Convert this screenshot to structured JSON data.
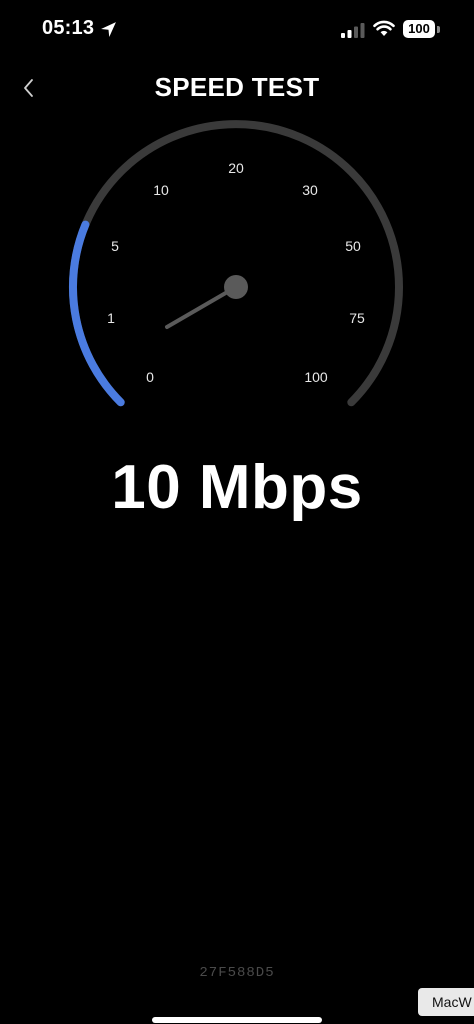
{
  "status_bar": {
    "time": "05:13",
    "battery": "100",
    "icons": [
      "location-arrow-icon",
      "cellular-signal-icon",
      "wifi-icon",
      "battery-icon"
    ]
  },
  "header": {
    "back_icon": "chevron-left-icon",
    "title": "SPEED TEST"
  },
  "gauge": {
    "tick_labels": [
      "0",
      "1",
      "5",
      "10",
      "20",
      "30",
      "50",
      "75",
      "100"
    ],
    "current_value": 10,
    "max_value": 100,
    "arc_fill_fraction": 0.25,
    "colors": {
      "active": "#4a7be0",
      "track": "#3a3a3a",
      "needle": "#5a5a5a"
    }
  },
  "readout": {
    "value": "10 Mbps"
  },
  "footer": {
    "device_code": "27F588D5",
    "watermark": "MacW"
  }
}
